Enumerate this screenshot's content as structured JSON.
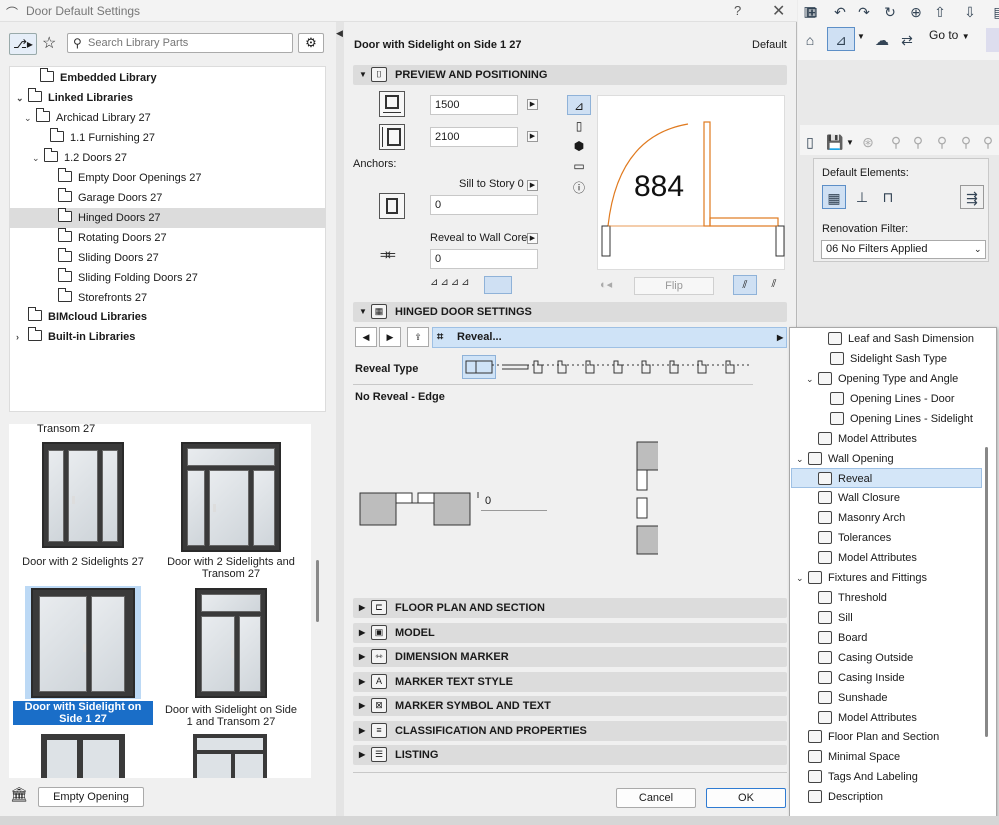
{
  "dialog": {
    "title": "Door Default Settings",
    "help": "?",
    "close": "✕"
  },
  "library": {
    "search_placeholder": "Search Library Parts",
    "tree": [
      {
        "label": "Embedded Library",
        "bold": true
      },
      {
        "label": "Linked Libraries",
        "bold": true
      },
      {
        "label": "Archicad Library 27"
      },
      {
        "label": "1.1 Furnishing 27"
      },
      {
        "label": "1.2 Doors 27"
      },
      {
        "label": "Empty Door Openings 27"
      },
      {
        "label": "Garage Doors 27"
      },
      {
        "label": "Hinged Doors 27"
      },
      {
        "label": "Rotating Doors 27"
      },
      {
        "label": "Sliding Doors 27"
      },
      {
        "label": "Sliding Folding Doors 27"
      },
      {
        "label": "Storefronts 27"
      },
      {
        "label": "BIMcloud Libraries",
        "bold": true
      },
      {
        "label": "Built-in Libraries",
        "bold": true
      }
    ],
    "thumbs": {
      "top_caption": "Transom 27",
      "items": [
        "Door with 2 Sidelights 27",
        "Door with 2 Sidelights and Transom 27",
        "Door with Sidelight on Side 1 27",
        "Door with Sidelight on Side 1 and Transom 27"
      ]
    },
    "empty_opening_label": "Empty Opening"
  },
  "settings": {
    "object_name": "Door with Sidelight on Side 1 27",
    "default_label": "Default",
    "preview_section": "PREVIEW AND POSITIONING",
    "width_value": "1500",
    "height_value": "2100",
    "anchors_label": "Anchors:",
    "sill_label": "Sill to Story 0",
    "sill_value": "0",
    "reveal_label": "Reveal to Wall Core",
    "reveal_value": "0",
    "preview_number": "884",
    "flip_label": "Flip",
    "hinged_section": "HINGED DOOR SETTINGS",
    "page_selector": "Reveal...",
    "reveal_type_label": "Reveal Type",
    "no_reveal_label": "No Reveal - Edge",
    "reveal_depth_value": "0",
    "sections": [
      "FLOOR PLAN AND SECTION",
      "MODEL",
      "DIMENSION MARKER",
      "MARKER TEXT STYLE",
      "MARKER SYMBOL AND TEXT",
      "CLASSIFICATION AND PROPERTIES",
      "LISTING"
    ],
    "cancel_label": "Cancel",
    "ok_label": "OK"
  },
  "background_app": {
    "goto_label": "Go to",
    "default_elements_label": "Default Elements:",
    "renovation_filter_label": "Renovation Filter:",
    "renovation_filter_value": "06 No Filters Applied"
  },
  "popup_tree": [
    {
      "label": "Leaf and Sash Dimension",
      "level": 2
    },
    {
      "label": "Sidelight Sash Type",
      "level": 2
    },
    {
      "label": "Opening Type and Angle",
      "level": 1,
      "expanded": true
    },
    {
      "label": "Opening Lines - Door",
      "level": 2
    },
    {
      "label": "Opening Lines - Sidelight",
      "level": 2
    },
    {
      "label": "Model Attributes",
      "level": 1
    },
    {
      "label": "Wall Opening",
      "level": 0,
      "expanded": true
    },
    {
      "label": "Reveal",
      "level": 1,
      "selected": true
    },
    {
      "label": "Wall Closure",
      "level": 1
    },
    {
      "label": "Masonry Arch",
      "level": 1
    },
    {
      "label": "Tolerances",
      "level": 1
    },
    {
      "label": "Model Attributes",
      "level": 1
    },
    {
      "label": "Fixtures and Fittings",
      "level": 0,
      "expanded": true
    },
    {
      "label": "Threshold",
      "level": 1
    },
    {
      "label": "Sill",
      "level": 1
    },
    {
      "label": "Board",
      "level": 1
    },
    {
      "label": "Casing Outside",
      "level": 1
    },
    {
      "label": "Casing Inside",
      "level": 1
    },
    {
      "label": "Sunshade",
      "level": 1
    },
    {
      "label": "Model Attributes",
      "level": 1
    },
    {
      "label": "Floor Plan and Section",
      "level": 0
    },
    {
      "label": "Minimal Space",
      "level": 0
    },
    {
      "label": "Tags And Labeling",
      "level": 0
    },
    {
      "label": "Description",
      "level": 0
    }
  ],
  "colors": {
    "accent": "#1a6ec8",
    "selection": "#cfe3f7",
    "door_swing": "#e07a1f"
  }
}
